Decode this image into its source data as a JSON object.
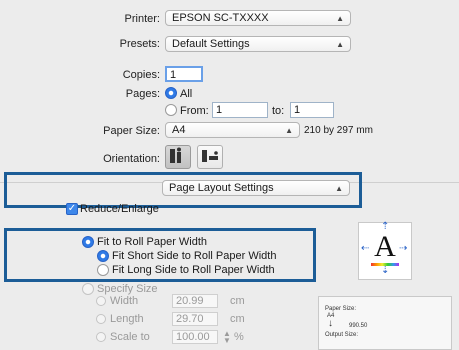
{
  "printer": {
    "label": "Printer:",
    "value": "EPSON SC-TXXXX"
  },
  "presets": {
    "label": "Presets:",
    "value": "Default Settings"
  },
  "copies": {
    "label": "Copies:",
    "value": "1"
  },
  "pages": {
    "label": "Pages:",
    "all": "All",
    "from_label": "From:",
    "from_value": "1",
    "to_label": "to:",
    "to_value": "1"
  },
  "paper_size": {
    "label": "Paper Size:",
    "value": "A4",
    "dimensions": "210 by 297 mm"
  },
  "orientation": {
    "label": "Orientation:"
  },
  "panel": {
    "value": "Page Layout Settings"
  },
  "reduce_enlarge": {
    "label": "Reduce/Enlarge",
    "checked": true
  },
  "fit_roll": {
    "label": "Fit to Roll Paper Width",
    "short": "Fit Short Side to Roll Paper Width",
    "long": "Fit Long Side to Roll Paper Width"
  },
  "specify": {
    "label": "Specify Size",
    "width_label": "Width",
    "width_value": "20.99",
    "width_unit": "cm",
    "length_label": "Length",
    "length_value": "29.70",
    "length_unit": "cm",
    "scale_label": "Scale to",
    "scale_value": "100.00",
    "scale_unit": "%"
  },
  "preview": {
    "glyph": "A",
    "paper_size_label": "Paper Size:",
    "paper_size_value": "A4",
    "arrow": "↓",
    "roll_value": "990.50",
    "output_size_label": "Output Size:"
  },
  "accent_color": "#1c5d97"
}
